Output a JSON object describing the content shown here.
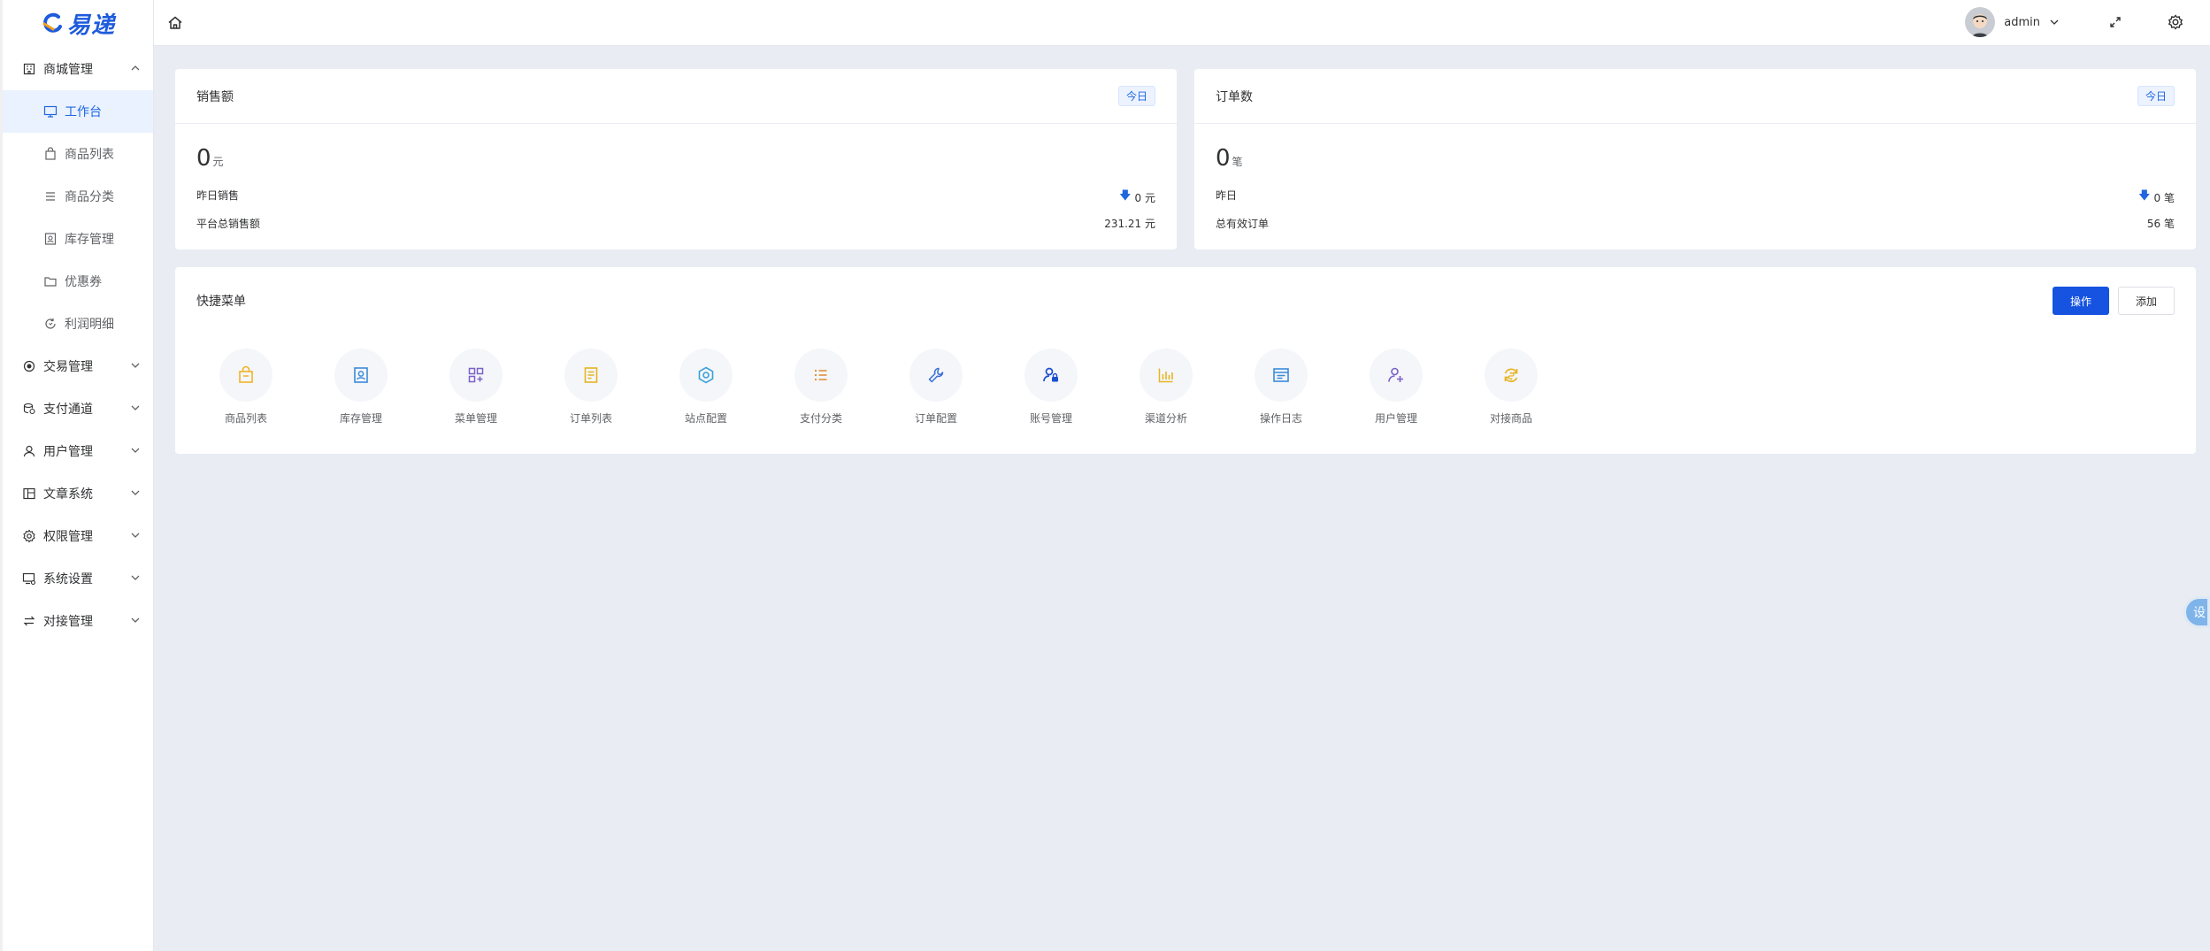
{
  "logo": {
    "text": "易递"
  },
  "sidebar": {
    "groups": [
      {
        "label": "商城管理",
        "expanded": true,
        "icon": "building-icon",
        "items": [
          {
            "label": "工作台",
            "icon": "monitor-icon",
            "active": true
          },
          {
            "label": "商品列表",
            "icon": "bag-icon"
          },
          {
            "label": "商品分类",
            "icon": "list-icon"
          },
          {
            "label": "库存管理",
            "icon": "id-card-icon"
          },
          {
            "label": "优惠券",
            "icon": "folder-icon"
          },
          {
            "label": "利润明细",
            "icon": "refresh-icon"
          }
        ]
      },
      {
        "label": "交易管理",
        "icon": "record-icon"
      },
      {
        "label": "支付通道",
        "icon": "coins-icon"
      },
      {
        "label": "用户管理",
        "icon": "user-icon"
      },
      {
        "label": "文章系统",
        "icon": "layout-icon"
      },
      {
        "label": "权限管理",
        "icon": "gear-icon"
      },
      {
        "label": "系统设置",
        "icon": "screen-settings-icon"
      },
      {
        "label": "对接管理",
        "icon": "switch-icon"
      }
    ]
  },
  "header": {
    "username": "admin"
  },
  "sales_card": {
    "title": "销售额",
    "tag": "今日",
    "value": "0",
    "unit": "元",
    "row1_label": "昨日销售",
    "row1_value": "0 元",
    "row2_label": "平台总销售额",
    "row2_value": "231.21 元"
  },
  "orders_card": {
    "title": "订单数",
    "tag": "今日",
    "value": "0",
    "unit": "笔",
    "row1_label": "昨日",
    "row1_value": "0 笔",
    "row2_label": "总有效订单",
    "row2_value": "56 笔"
  },
  "quick_menu": {
    "title": "快捷菜单",
    "btn_operate": "操作",
    "btn_add": "添加",
    "items": [
      {
        "label": "商品列表",
        "icon": "bag-icon",
        "color": "#f0b429"
      },
      {
        "label": "库存管理",
        "icon": "id-card-icon",
        "color": "#3b8bd9"
      },
      {
        "label": "菜单管理",
        "icon": "grid-plus-icon",
        "color": "#7b61c9"
      },
      {
        "label": "订单列表",
        "icon": "document-icon",
        "color": "#e6b422"
      },
      {
        "label": "站点配置",
        "icon": "hexagon-icon",
        "color": "#3aa0d8"
      },
      {
        "label": "支付分类",
        "icon": "list-icon",
        "color": "#e08a2e"
      },
      {
        "label": "订单配置",
        "icon": "wrench-icon",
        "color": "#3b6fd9"
      },
      {
        "label": "账号管理",
        "icon": "user-lock-icon",
        "color": "#1c4fd0"
      },
      {
        "label": "渠道分析",
        "icon": "bar-chart-icon",
        "color": "#e6b422"
      },
      {
        "label": "操作日志",
        "icon": "log-icon",
        "color": "#3b8bd9"
      },
      {
        "label": "用户管理",
        "icon": "user-add-icon",
        "color": "#7b61c9"
      },
      {
        "label": "对接商品",
        "icon": "exchange-icon",
        "color": "#e6b422"
      }
    ]
  },
  "float_tab": {
    "text": "设"
  }
}
